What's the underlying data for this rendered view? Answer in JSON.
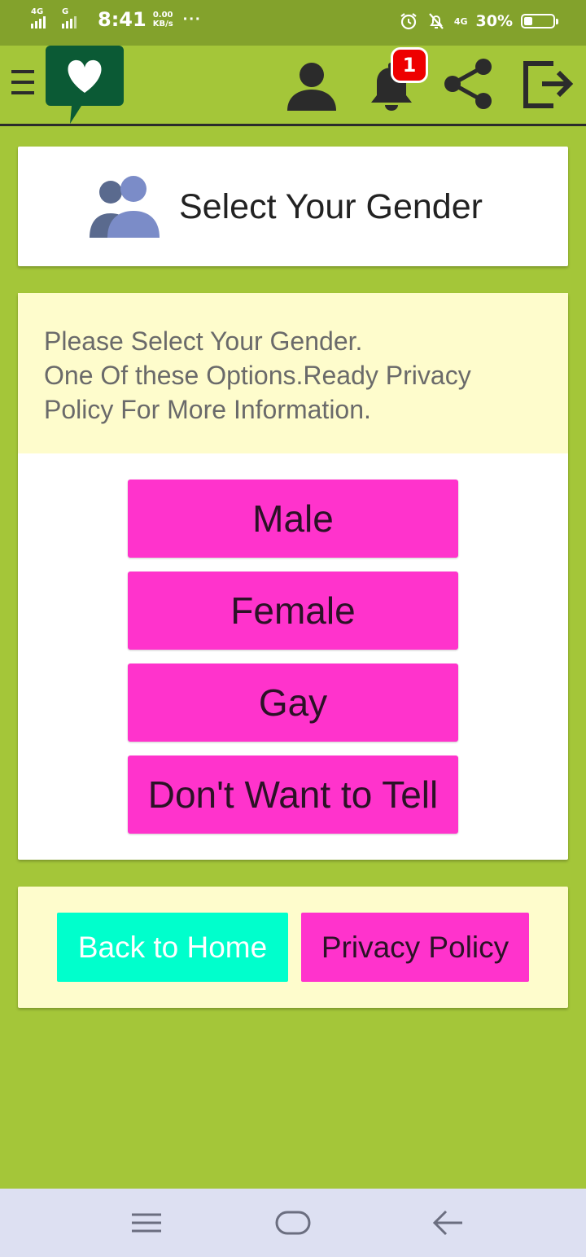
{
  "status_bar": {
    "net1": "4G",
    "net2": "G",
    "time": "8:41",
    "speed_value": "0.00",
    "speed_unit": "KB/s",
    "more": "···",
    "net3": "4G",
    "battery_percent": "30%"
  },
  "toolbar": {
    "notification_count": "1"
  },
  "header": {
    "title": "Select Your Gender"
  },
  "info": {
    "line1": "Please Select Your Gender.",
    "line2": "One Of these Options.Ready Privacy",
    "line3": "Policy For More Information."
  },
  "gender_options": [
    "Male",
    "Female",
    "Gay",
    "Don't Want to Tell"
  ],
  "footer": {
    "back_label": "Back to Home",
    "privacy_label": "Privacy Policy"
  },
  "colors": {
    "background": "#a4c639",
    "status_bar": "#83a22c",
    "gender_button": "#ff33cc",
    "back_button": "#00ffcc",
    "note_background": "#fefccc",
    "badge": "#ee0000"
  }
}
